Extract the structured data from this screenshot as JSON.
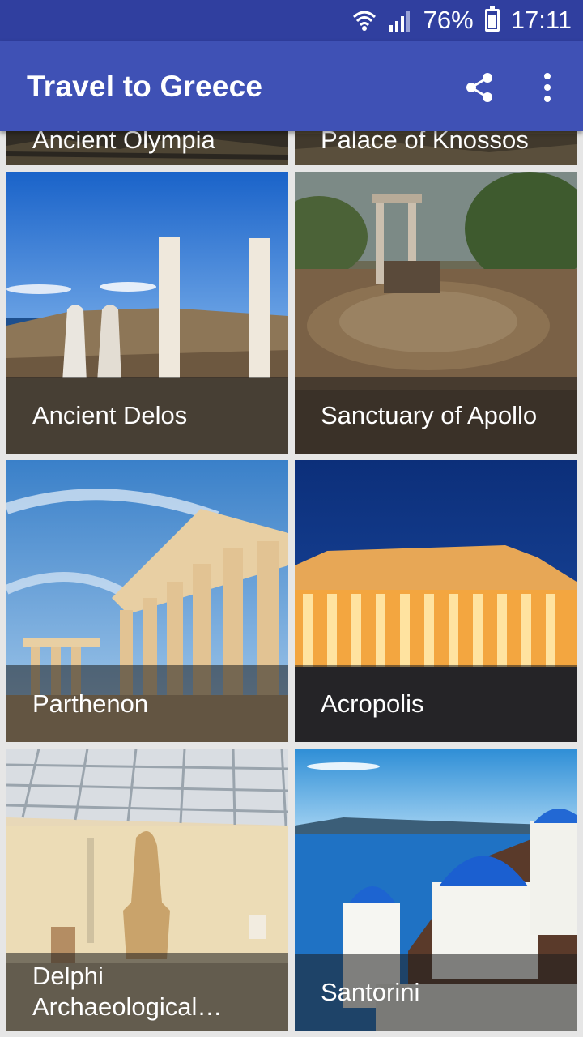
{
  "status_bar": {
    "battery_percent": "76%",
    "time": "17:11",
    "icons": [
      "wifi-icon",
      "signal-icon",
      "battery-icon"
    ],
    "background": "#303f9f"
  },
  "app_bar": {
    "title": "Travel to Greece",
    "background": "#3f51b5",
    "actions": [
      "share-icon",
      "more-vert-icon"
    ]
  },
  "places": [
    {
      "name": "Ancient Olympia"
    },
    {
      "name": "Palace of Knossos"
    },
    {
      "name": "Ancient Delos"
    },
    {
      "name": "Sanctuary of Apollo"
    },
    {
      "name": "Parthenon"
    },
    {
      "name": "Acropolis"
    },
    {
      "name": "Delphi Archaeological…"
    },
    {
      "name": "Santorini"
    }
  ]
}
